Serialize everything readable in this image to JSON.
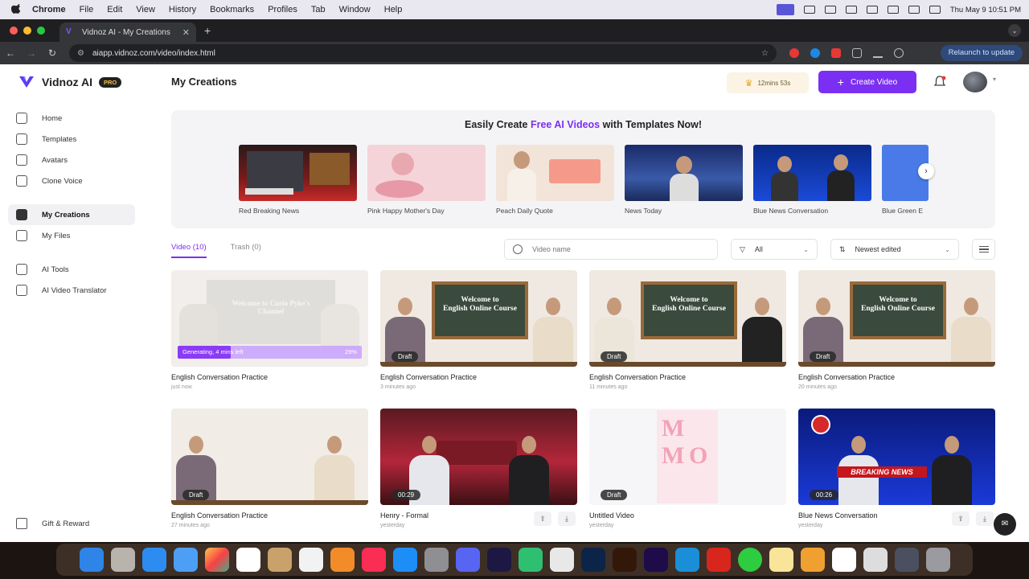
{
  "menubar": {
    "items": [
      "Chrome",
      "File",
      "Edit",
      "View",
      "History",
      "Bookmarks",
      "Profiles",
      "Tab",
      "Window",
      "Help"
    ],
    "clock": "Thu May 9  10:51 PM"
  },
  "browser": {
    "tab_title": "Vidnoz AI - My Creations",
    "url": "aiapp.vidnoz.com/video/index.html",
    "relaunch_label": "Relaunch to update"
  },
  "app": {
    "brand": "Vidnoz AI",
    "pro_badge": "PRO",
    "page_title": "My Creations",
    "credits": "12mins 53s",
    "create_button": "Create Video",
    "nav": [
      {
        "label": "Home",
        "icon": "home-icon"
      },
      {
        "label": "Templates",
        "icon": "templates-icon"
      },
      {
        "label": "Avatars",
        "icon": "avatars-icon"
      },
      {
        "label": "Clone Voice",
        "icon": "clone-voice-icon"
      },
      {
        "label": "My Creations",
        "icon": "my-creations-icon",
        "active": true
      },
      {
        "label": "My Files",
        "icon": "my-files-icon"
      },
      {
        "label": "AI Tools",
        "icon": "ai-tools-icon"
      },
      {
        "label": "AI Video Translator",
        "icon": "translator-icon"
      }
    ],
    "gift_label": "Gift & Reward"
  },
  "banner": {
    "title_pre": "Easily Create ",
    "title_hl": "Free AI Videos",
    "title_post": " with Templates Now!",
    "templates": [
      {
        "name": "Red Breaking News"
      },
      {
        "name": "Pink Happy Mother's Day"
      },
      {
        "name": "Peach Daily Quote"
      },
      {
        "name": "News Today"
      },
      {
        "name": "Blue News Conversation"
      },
      {
        "name": "Blue Green E"
      }
    ]
  },
  "tabs": {
    "video": "Video (10)",
    "trash": "Trash (0)"
  },
  "filters": {
    "search_placeholder": "Video name",
    "filter_value": "All",
    "sort_value": "Newest edited"
  },
  "videos": [
    {
      "title": "English Conversation Practice",
      "time": "just now",
      "status": "Generating, 4 mins left",
      "progress_pct": "29%",
      "progress": 0.29
    },
    {
      "title": "English Conversation Practice",
      "time": "3 minutes ago",
      "badge": "Draft"
    },
    {
      "title": "English Conversation Practice",
      "time": "11 minutes ago",
      "badge": "Draft"
    },
    {
      "title": "English Conversation Practice",
      "time": "20 minutes ago",
      "badge": "Draft"
    },
    {
      "title": "English Conversation Practice",
      "time": "27 minutes ago",
      "badge": "Draft"
    },
    {
      "title": "Henry - Formal",
      "time": "yesterday",
      "badge": "00:29"
    },
    {
      "title": "Untitled Video",
      "time": "yesterday",
      "badge": "Draft"
    },
    {
      "title": "Blue News Conversation",
      "time": "yesterday",
      "badge": "00:26"
    }
  ],
  "thumb_text": {
    "welcome_channel": "Welcome to Curio Pyke's Channel",
    "welcome_course_1": "Welcome to",
    "welcome_course_2": "English Online Course",
    "breaking_news": "BREAKING NEWS"
  },
  "colors": {
    "accent": "#7b2ff2",
    "brand_dark": "#222222"
  }
}
